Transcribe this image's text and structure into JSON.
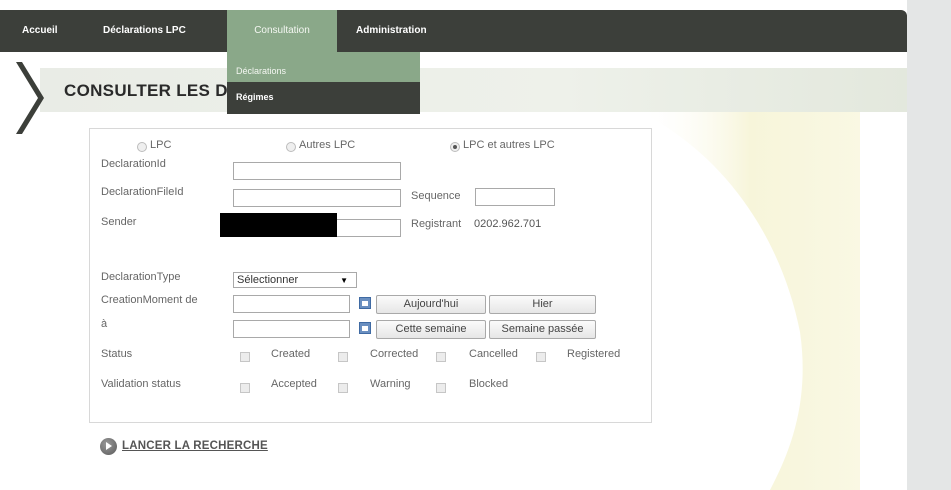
{
  "nav": {
    "items": [
      {
        "label": "Accueil"
      },
      {
        "label": "Déclarations LPC"
      },
      {
        "label": "Consultation"
      },
      {
        "label": "Administration"
      }
    ]
  },
  "dropdown": {
    "items": [
      {
        "label": "Déclarations"
      },
      {
        "label": "Régimes"
      }
    ]
  },
  "page": {
    "title": "CONSULTER LES D"
  },
  "form": {
    "radios": [
      {
        "label": "LPC",
        "checked": false
      },
      {
        "label": "Autres LPC",
        "checked": false
      },
      {
        "label": "LPC et autres LPC",
        "checked": true
      }
    ],
    "declaration_id_label": "DeclarationId",
    "declaration_file_id_label": "DeclarationFileId",
    "sequence_label": "Sequence",
    "sender_label": "Sender",
    "registrant_label": "Registrant",
    "registrant_value": "0202.962.701",
    "declaration_type_label": "DeclarationType",
    "declaration_type_value": "Sélectionner",
    "creation_moment_label": "CreationMoment de",
    "to_label": "à",
    "buttons": {
      "today": "Aujourd'hui",
      "yesterday": "Hier",
      "this_week": "Cette semaine",
      "last_week": "Semaine passée"
    },
    "status_label": "Status",
    "statuses": [
      "Created",
      "Corrected",
      "Cancelled",
      "Registered"
    ],
    "validation_status_label": "Validation status",
    "validation_statuses": [
      "Accepted",
      "Warning",
      "Blocked"
    ]
  },
  "search": {
    "label": "LANCER LA RECHERCHE"
  },
  "colors": {
    "nav_bg": "#3c3f3a",
    "nav_active": "#8aa889",
    "accent_yellow": "#f7f4c8"
  }
}
